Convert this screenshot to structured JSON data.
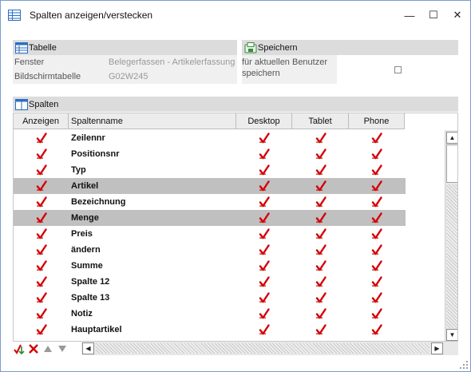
{
  "window": {
    "title": "Spalten anzeigen/verstecken",
    "minimize_glyph": "—",
    "maximize_glyph": "☐",
    "close_glyph": "✕"
  },
  "tabelle": {
    "header": "Tabelle",
    "icon": "table-icon",
    "fields": [
      {
        "label": "Fenster",
        "value": "Belegerfassen - Artikelerfassung"
      },
      {
        "label": "Bildschirmtabelle",
        "value": "G02W245"
      }
    ]
  },
  "speichern": {
    "header": "Speichern",
    "icon": "save-icon",
    "option_label": "für aktuellen Benutzer speichern",
    "option_checked": false
  },
  "spalten": {
    "header": "Spalten",
    "icon": "columns-icon",
    "columns": [
      "Anzeigen",
      "Spaltenname",
      "Desktop",
      "Tablet",
      "Phone"
    ],
    "rows": [
      {
        "name": "Zeilennr",
        "show": true,
        "desktop": true,
        "tablet": true,
        "phone": true,
        "selected": false
      },
      {
        "name": "Positionsnr",
        "show": true,
        "desktop": true,
        "tablet": true,
        "phone": true,
        "selected": false
      },
      {
        "name": "Typ",
        "show": true,
        "desktop": true,
        "tablet": true,
        "phone": true,
        "selected": false
      },
      {
        "name": "Artikel",
        "show": true,
        "desktop": true,
        "tablet": true,
        "phone": true,
        "selected": true
      },
      {
        "name": "Bezeichnung",
        "show": true,
        "desktop": true,
        "tablet": true,
        "phone": true,
        "selected": false
      },
      {
        "name": "Menge",
        "show": true,
        "desktop": true,
        "tablet": true,
        "phone": true,
        "selected": true
      },
      {
        "name": "Preis",
        "show": true,
        "desktop": true,
        "tablet": true,
        "phone": true,
        "selected": false
      },
      {
        "name": "ändern",
        "show": true,
        "desktop": true,
        "tablet": true,
        "phone": true,
        "selected": false
      },
      {
        "name": "Summe",
        "show": true,
        "desktop": true,
        "tablet": true,
        "phone": true,
        "selected": false
      },
      {
        "name": "Spalte 12",
        "show": true,
        "desktop": true,
        "tablet": true,
        "phone": true,
        "selected": false
      },
      {
        "name": "Spalte 13",
        "show": true,
        "desktop": true,
        "tablet": true,
        "phone": true,
        "selected": false
      },
      {
        "name": "Notiz",
        "show": true,
        "desktop": true,
        "tablet": true,
        "phone": true,
        "selected": false
      },
      {
        "name": "Hauptartikel",
        "show": true,
        "desktop": true,
        "tablet": true,
        "phone": true,
        "selected": false
      }
    ]
  },
  "footer_tools": [
    "select-all-icon",
    "deselect-icon",
    "move-up-icon",
    "move-down-icon"
  ],
  "colors": {
    "check_red": "#d40000",
    "selected_row": "#c0c0c0",
    "group_header": "#dcdcdc"
  }
}
